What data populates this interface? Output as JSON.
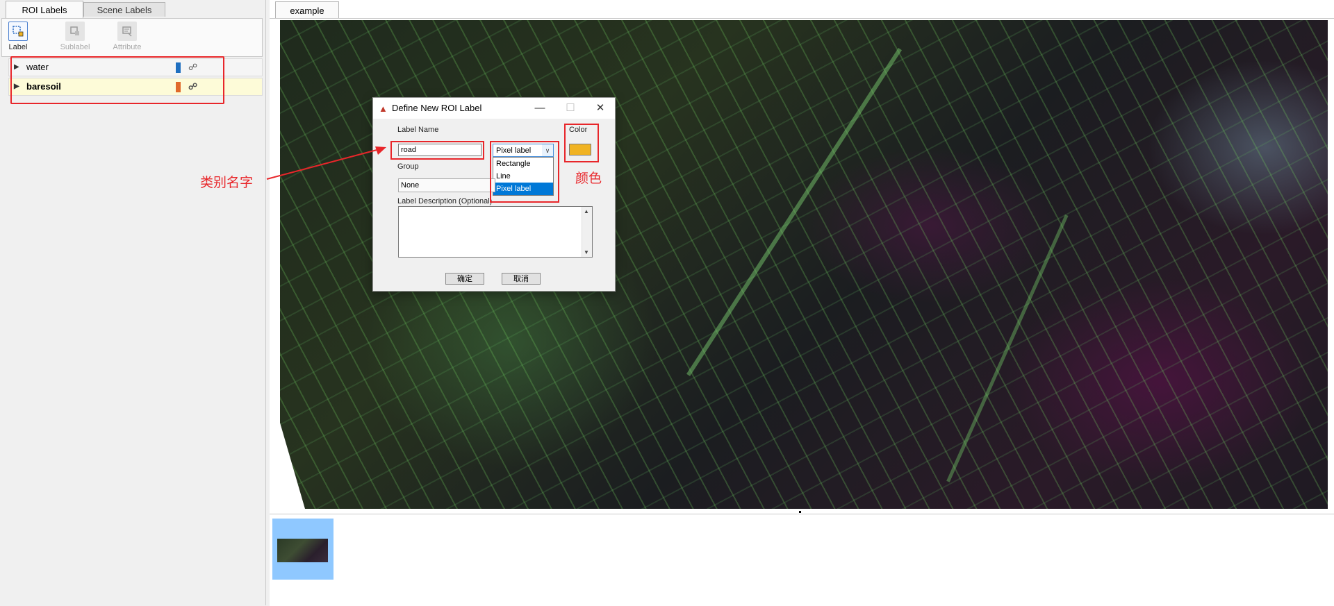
{
  "left_panel": {
    "tabs": [
      {
        "label": "ROI Labels",
        "active": true
      },
      {
        "label": "Scene Labels",
        "active": false
      }
    ],
    "toolstrip": {
      "label": "Label",
      "sublabel": "Sublabel",
      "attribute": "Attribute"
    },
    "labels": [
      {
        "name": "water",
        "color": "#1f6fc0",
        "selected": false
      },
      {
        "name": "baresoil",
        "color": "#e0692a",
        "selected": true
      }
    ]
  },
  "right_panel": {
    "tab": "example"
  },
  "dialog": {
    "title": "Define New ROI Label",
    "label_name_caption": "Label Name",
    "label_name_value": "road",
    "type_selected": "Pixel label",
    "type_options": [
      "Rectangle",
      "Line",
      "Pixel label"
    ],
    "color_caption": "Color",
    "color_value": "#f0b323",
    "group_caption": "Group",
    "group_value": "None",
    "description_caption": "Label Description (Optional)",
    "ok_label": "确定",
    "cancel_label": "取消"
  },
  "annotations": {
    "name_note": "类别名字",
    "color_note": "颜色",
    "accent": "#e8262a"
  }
}
